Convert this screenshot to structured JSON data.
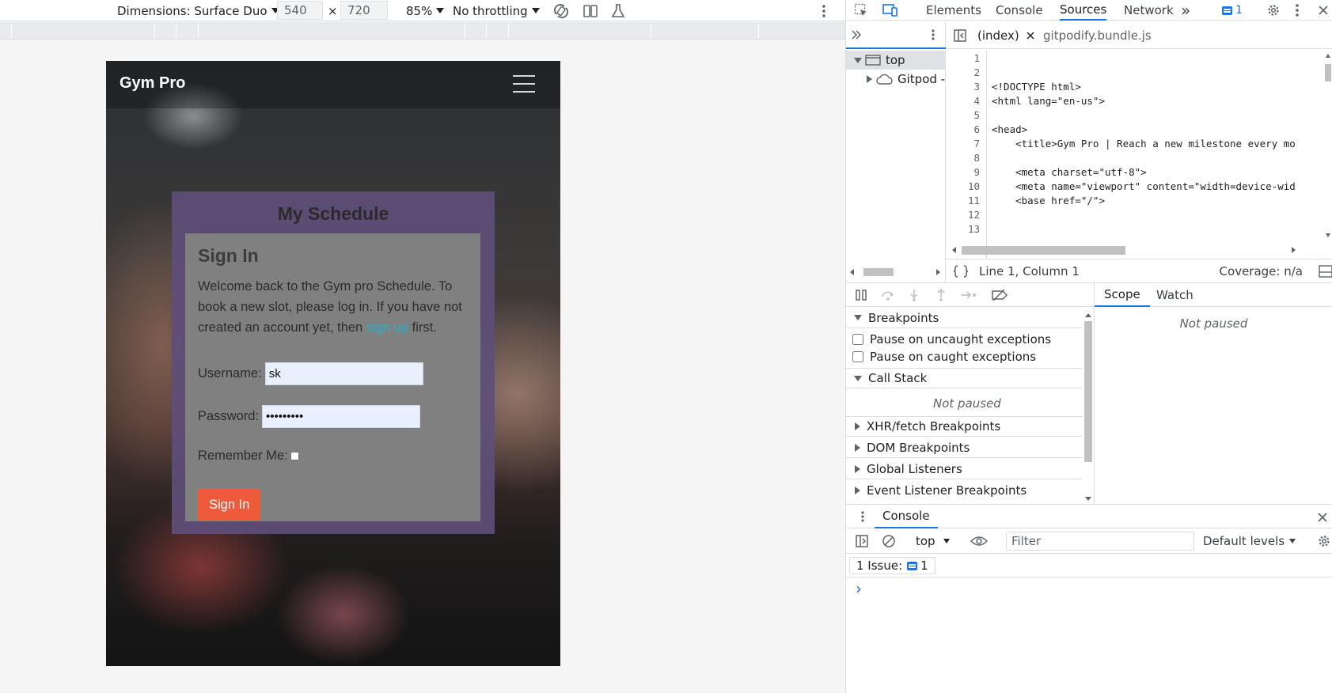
{
  "emulation": {
    "dimensions_label": "Dimensions: Surface Duo",
    "width": "540",
    "times": "×",
    "height": "720",
    "zoom": "85%",
    "throttling": "No throttling"
  },
  "site": {
    "brand": "Gym Pro",
    "schedule_title": "My Schedule",
    "signin_title": "Sign In",
    "intro_before": "Welcome back to the Gym pro Schedule. To book a new slot, please log in. If you have not created an account yet, then ",
    "intro_link": "sign up",
    "intro_after": " first.",
    "username_label": "Username:",
    "username_value": "sk",
    "password_label": "Password:",
    "password_value": "•••••••••",
    "remember_label": "Remember Me:",
    "signin_button": "Sign In",
    "colors": {
      "panel": "#5e4e7a",
      "card": "#808080",
      "button": "#ee5a3a",
      "link": "#1fb1c9"
    }
  },
  "devtools": {
    "tabs": [
      "Elements",
      "Console",
      "Sources",
      "Network"
    ],
    "active_tab": "Sources",
    "more_tabs": "»",
    "issues_count": "1",
    "navigator": {
      "top": "top",
      "gitpod": "Gitpod -"
    },
    "editor_tabs": [
      "(index)",
      "gitpodify.bundle.js"
    ],
    "code_lines": [
      {
        "n": "1",
        "html": ""
      },
      {
        "n": "2",
        "html": ""
      },
      {
        "n": "3",
        "html": "<!DOCTYPE html>"
      },
      {
        "n": "4",
        "html": "<html lang=\"en-us\">"
      },
      {
        "n": "5",
        "html": ""
      },
      {
        "n": "6",
        "html": "<head>"
      },
      {
        "n": "7",
        "html": "    <title>Gym Pro | Reach a new milestone every mo"
      },
      {
        "n": "8",
        "html": ""
      },
      {
        "n": "9",
        "html": "    <meta charset=\"utf-8\">"
      },
      {
        "n": "10",
        "html": "    <meta name=\"viewport\" content=\"width=device-wid"
      },
      {
        "n": "11",
        "html": "    <base href=\"/\">"
      },
      {
        "n": "12",
        "html": ""
      },
      {
        "n": "13",
        "html": ""
      }
    ],
    "cursor_position": "Line 1, Column 1",
    "coverage": "Coverage: n/a",
    "breakpoints": "Breakpoints",
    "pause_uncaught": "Pause on uncaught exceptions",
    "pause_caught": "Pause on caught exceptions",
    "call_stack": "Call Stack",
    "not_paused": "Not paused",
    "xhr_breakpoints": "XHR/fetch Breakpoints",
    "dom_breakpoints": "DOM Breakpoints",
    "global_listeners": "Global Listeners",
    "event_listener_breakpoints": "Event Listener Breakpoints",
    "scope_tab": "Scope",
    "watch_tab": "Watch",
    "scope_not_paused": "Not paused",
    "console": {
      "title": "Console",
      "context": "top",
      "filter_placeholder": "Filter",
      "levels": "Default levels",
      "issues_label": "1 Issue:",
      "issues_count": "1",
      "prompt": "›"
    }
  }
}
